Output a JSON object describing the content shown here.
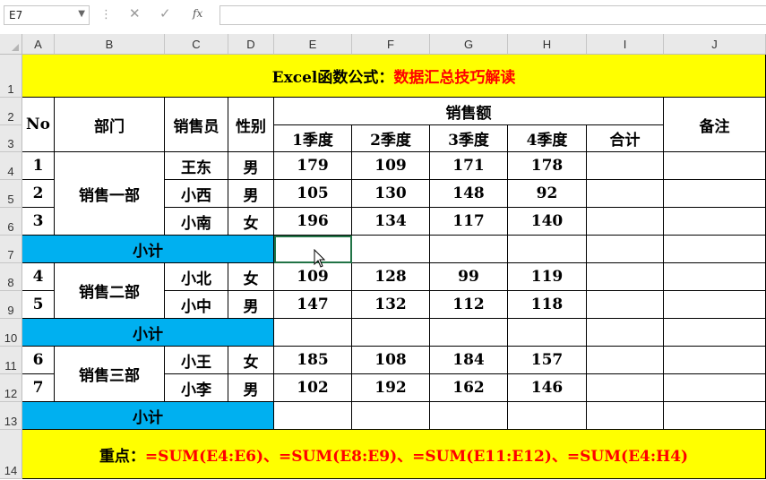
{
  "formula_bar": {
    "name_box": "E7",
    "fx": "fx",
    "formula": ""
  },
  "columns": [
    "A",
    "B",
    "C",
    "D",
    "E",
    "F",
    "G",
    "H",
    "I",
    "J"
  ],
  "rows": [
    "1",
    "2",
    "3",
    "4",
    "5",
    "6",
    "7",
    "8",
    "9",
    "10",
    "11",
    "12",
    "13",
    "14"
  ],
  "title": {
    "black": "Excel函数公式：",
    "red": "数据汇总技巧解读"
  },
  "headers": {
    "no": "No",
    "dept": "部门",
    "salesperson": "销售员",
    "gender": "性别",
    "sales": "销售额",
    "q1": "1季度",
    "q2": "2季度",
    "q3": "3季度",
    "q4": "4季度",
    "total": "合计",
    "remark": "备注"
  },
  "groups": [
    {
      "dept": "销售一部",
      "rows": [
        {
          "no": "1",
          "name": "王东",
          "gender": "男",
          "q1": "179",
          "q2": "109",
          "q3": "171",
          "q4": "178"
        },
        {
          "no": "2",
          "name": "小西",
          "gender": "男",
          "q1": "105",
          "q2": "130",
          "q3": "148",
          "q4": "92"
        },
        {
          "no": "3",
          "name": "小南",
          "gender": "女",
          "q1": "196",
          "q2": "134",
          "q3": "117",
          "q4": "140"
        }
      ],
      "subtotal": "小计"
    },
    {
      "dept": "销售二部",
      "rows": [
        {
          "no": "4",
          "name": "小北",
          "gender": "女",
          "q1": "109",
          "q2": "128",
          "q3": "99",
          "q4": "119"
        },
        {
          "no": "5",
          "name": "小中",
          "gender": "男",
          "q1": "147",
          "q2": "132",
          "q3": "112",
          "q4": "118"
        }
      ],
      "subtotal": "小计"
    },
    {
      "dept": "销售三部",
      "rows": [
        {
          "no": "6",
          "name": "小王",
          "gender": "女",
          "q1": "185",
          "q2": "108",
          "q3": "184",
          "q4": "157"
        },
        {
          "no": "7",
          "name": "小李",
          "gender": "男",
          "q1": "102",
          "q2": "192",
          "q3": "162",
          "q4": "146"
        }
      ],
      "subtotal": "小计"
    }
  ],
  "footer": {
    "label": "重点：",
    "formulas": "=SUM(E4:E6)、=SUM(E8:E9)、=SUM(E11:E12)、=SUM(E4:H4)"
  },
  "colors": {
    "yellow": "#ffff00",
    "blue": "#00b0f0",
    "red": "#ff0000",
    "selection": "#217346"
  }
}
